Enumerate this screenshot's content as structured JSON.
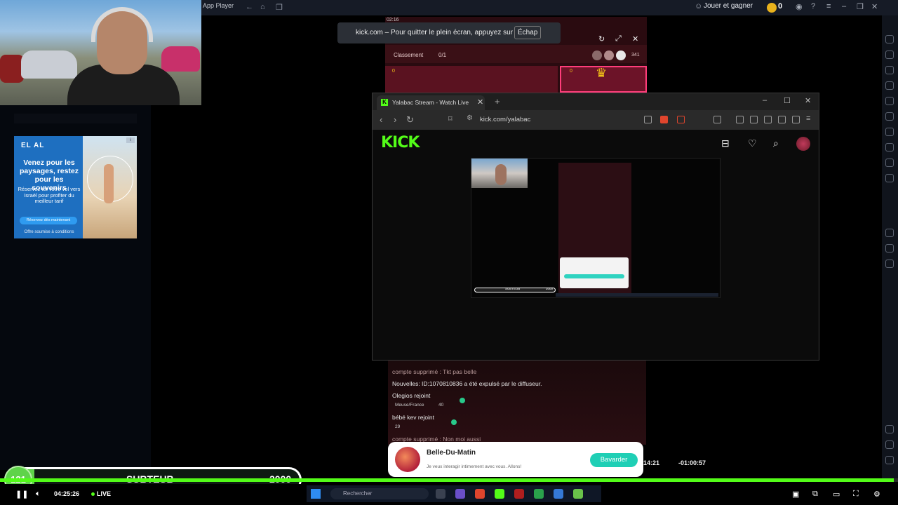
{
  "app_player": {
    "title": "App Player",
    "rewards_label": "Jouer et gagner",
    "coins": "0"
  },
  "fullscreen_toast": {
    "message": "kick.com – Pour quitter le plein écran, appuyez sur",
    "key": "Échap"
  },
  "game": {
    "time": "02:16",
    "ranking_label": "Classement",
    "stars": "0/1",
    "viewers": "341",
    "score_left": "0",
    "score_right": "0"
  },
  "ad": {
    "brand": "EL AL",
    "headline": "Venez pour les paysages, restez pour les souvenirs",
    "sub": "Réservez tôt votre vol vers Israël pour profiter du meilleur tarif",
    "cta": "Réservez dès maintenant",
    "footer": "Offre soumise à conditions"
  },
  "browser": {
    "tab_title": "Yalabac Stream - Watch Live",
    "url": "kick.com/yalabac",
    "logo": "KICK",
    "stream_bar_label": "SUBTEUB",
    "stream_bar_goal": "2000"
  },
  "chat": {
    "messages": [
      {
        "user": "compte supprimé",
        "text": "Tkt pas belle"
      },
      {
        "user": "",
        "text": "Nouvelles: ID:1070810836 a été expulsé par le diffuseur."
      },
      {
        "user": "Olegios",
        "text": "rejoint",
        "badge": "Meuse/France",
        "level": "40"
      },
      {
        "user": "bébé kev",
        "text": "rejoint",
        "level": "29"
      },
      {
        "user": "compte supprimé",
        "text": "Non moi aussi"
      }
    ]
  },
  "notification": {
    "name": "Belle-Du-Matin",
    "message": "Je veux interagir intimement avec vous. Allons!",
    "button": "Bavarder"
  },
  "timestamps": {
    "left": "14:21",
    "right": "-01:00:57"
  },
  "sub_goal": {
    "current": "121",
    "label": "SUBTEUB",
    "goal": "2000",
    "progress": 0.06
  },
  "player": {
    "time": "04:25:26",
    "live_label": "LIVE",
    "seek_progress": 0.995
  },
  "taskbar": {
    "search_placeholder": "Rechercher"
  },
  "colors": {
    "kick_green": "#53fc18",
    "accent_teal": "#1fcfb5",
    "sub_green": "#5fd34a"
  }
}
